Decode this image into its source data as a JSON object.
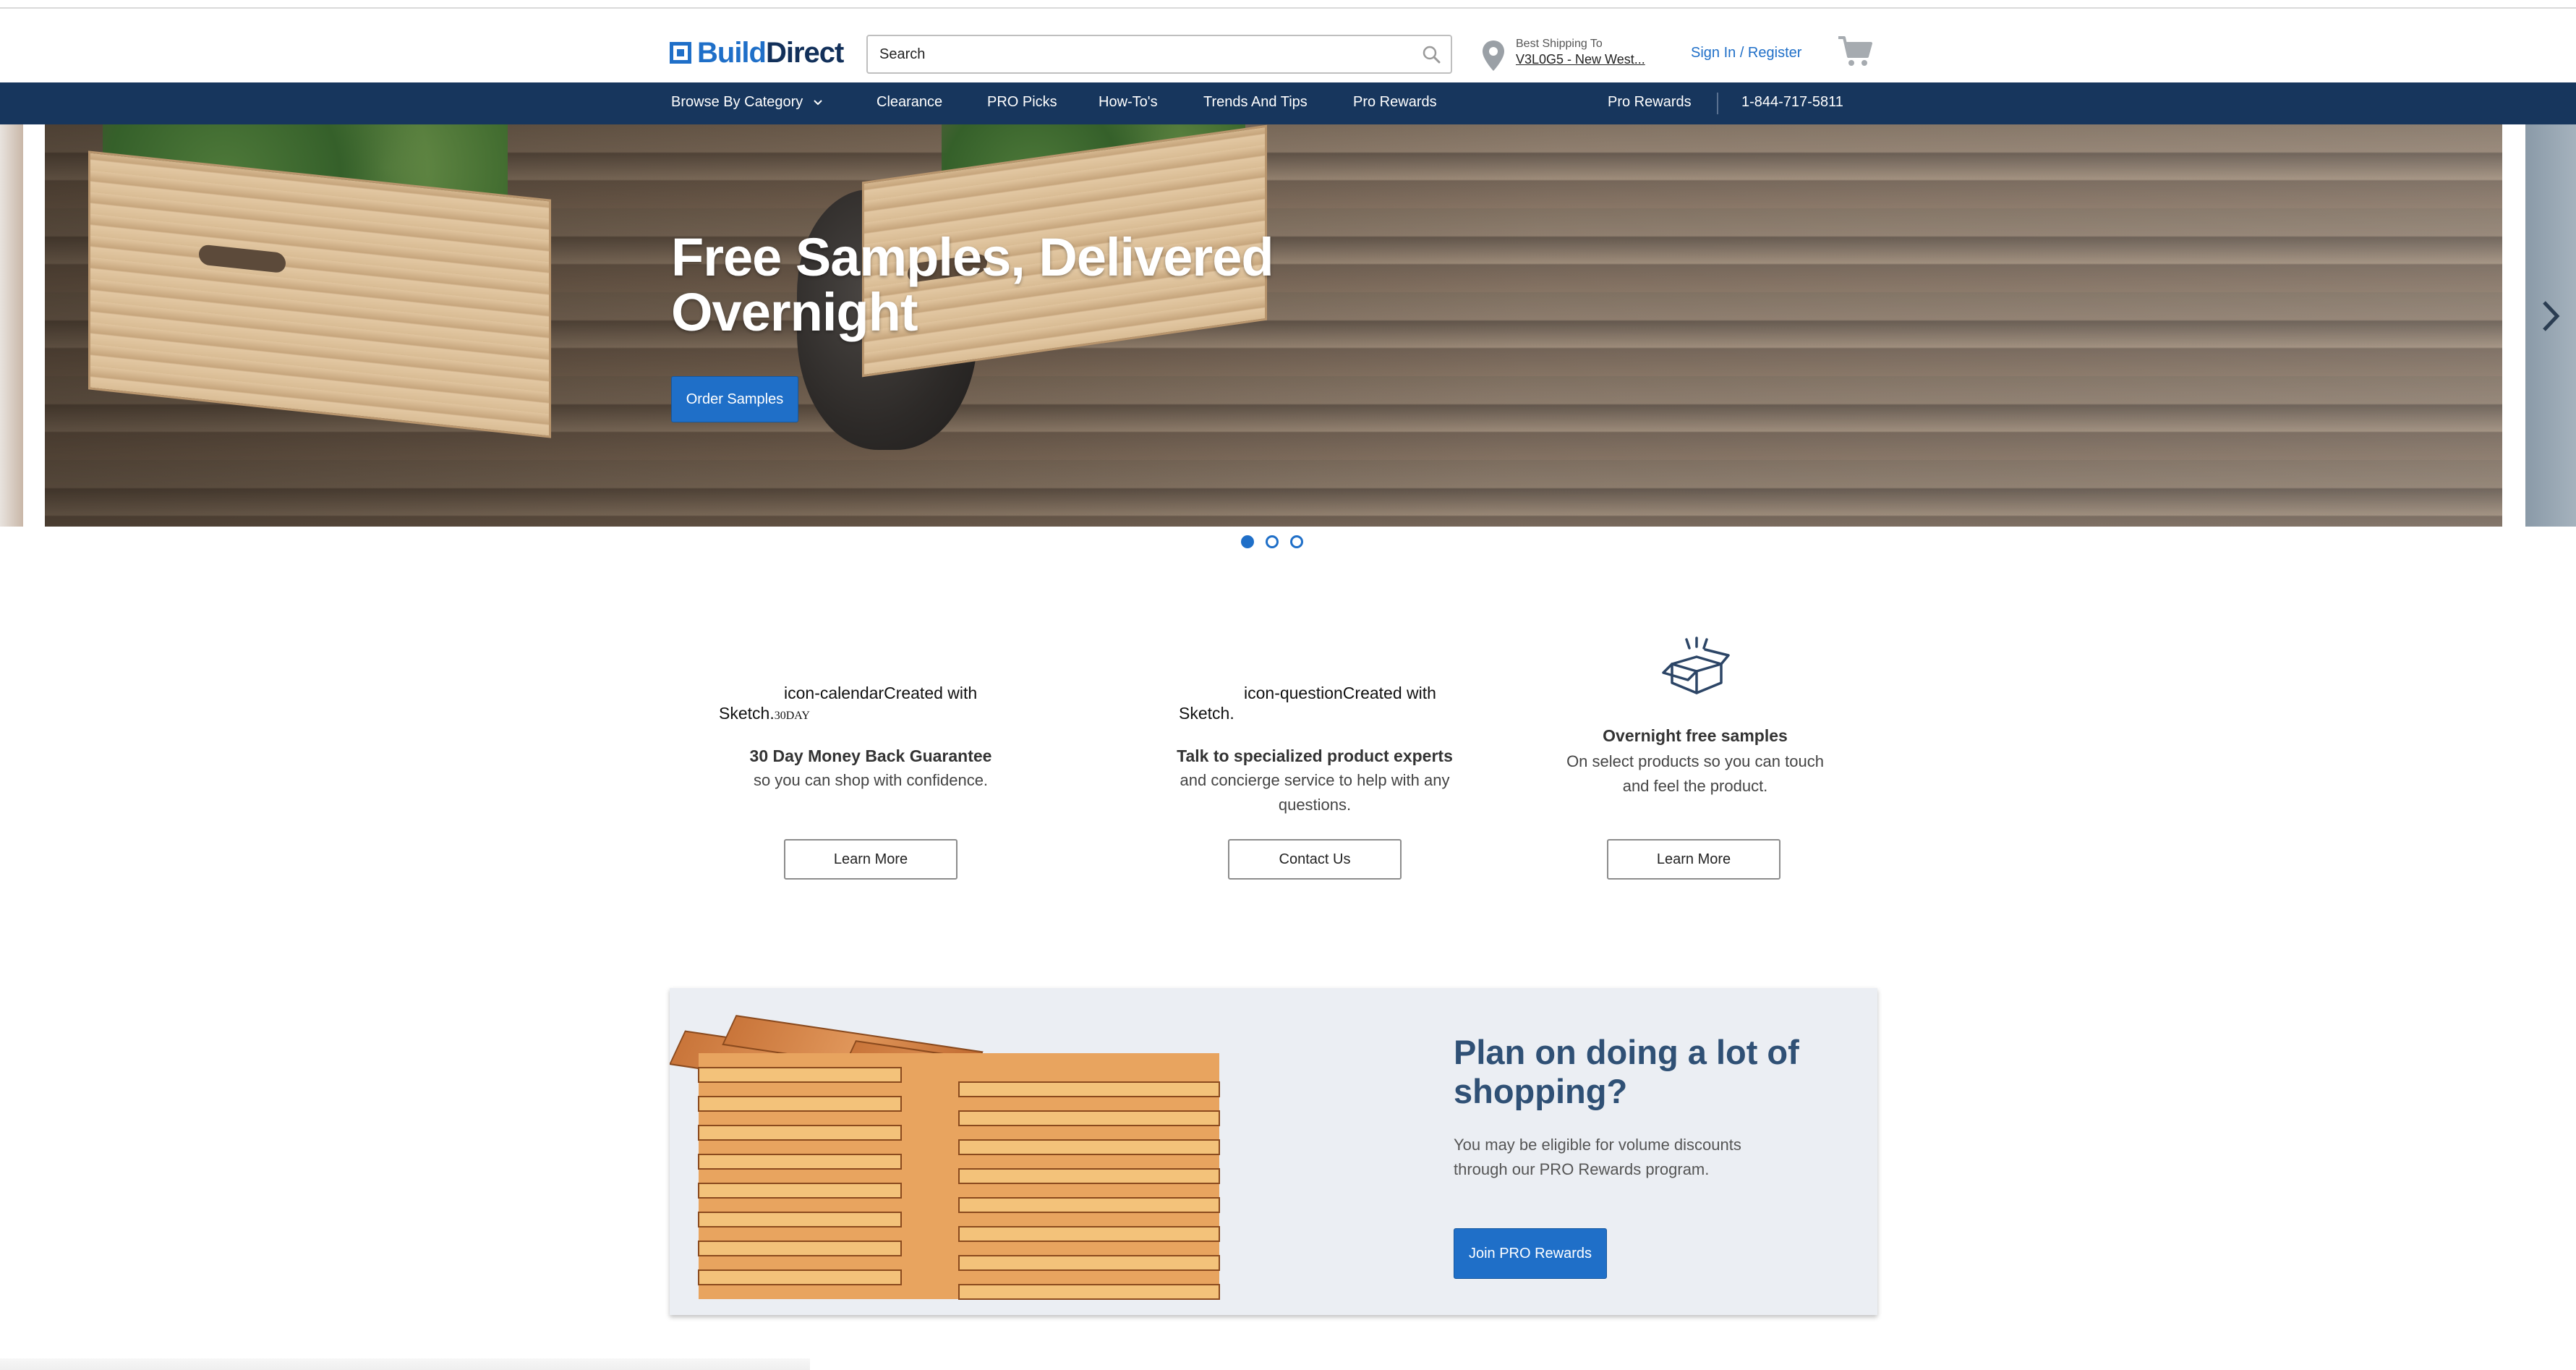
{
  "header": {
    "logo_text_build": "Build",
    "logo_text_direct": "Direct",
    "search_placeholder": "Search",
    "shipping_label": "Best Shipping To",
    "shipping_value": "V3L0G5 - New West...",
    "signin_label": "Sign In / Register"
  },
  "nav": {
    "browse_label": "Browse By Category",
    "items": [
      "Clearance",
      "PRO Picks",
      "How-To's",
      "Trends And Tips",
      "Pro Rewards"
    ],
    "right_items": [
      "Pro Rewards",
      "1-844-717-5811"
    ]
  },
  "hero": {
    "title": "Free Samples, Delivered Overnight",
    "button_label": "Order Samples",
    "slides": 3,
    "active_slide": 1
  },
  "value_props": [
    {
      "icon_alt_text": "icon-calendarCreated with Sketch.",
      "icon_alt_suffix": "30DAY",
      "title": "30 Day Money Back Guarantee",
      "text": "so you can shop with confidence.",
      "button_label": "Learn More"
    },
    {
      "icon_alt_text": "icon-questionCreated with Sketch.",
      "title": "Talk to specialized product experts",
      "text": "and concierge service to help with any questions.",
      "button_label": "Contact Us"
    },
    {
      "icon": "open-box-icon",
      "title": "Overnight free samples",
      "text": "On select products so you can touch and feel the product.",
      "button_label": "Learn More"
    }
  ],
  "promo": {
    "title": "Plan on doing a lot of shopping?",
    "text": "You may be eligible for volume discounts through our PRO Rewards program.",
    "button_label": "Join PRO Rewards"
  },
  "colors": {
    "brand_blue": "#1f6fc8",
    "nav_navy": "#17365d",
    "promo_title": "#2f5075"
  }
}
